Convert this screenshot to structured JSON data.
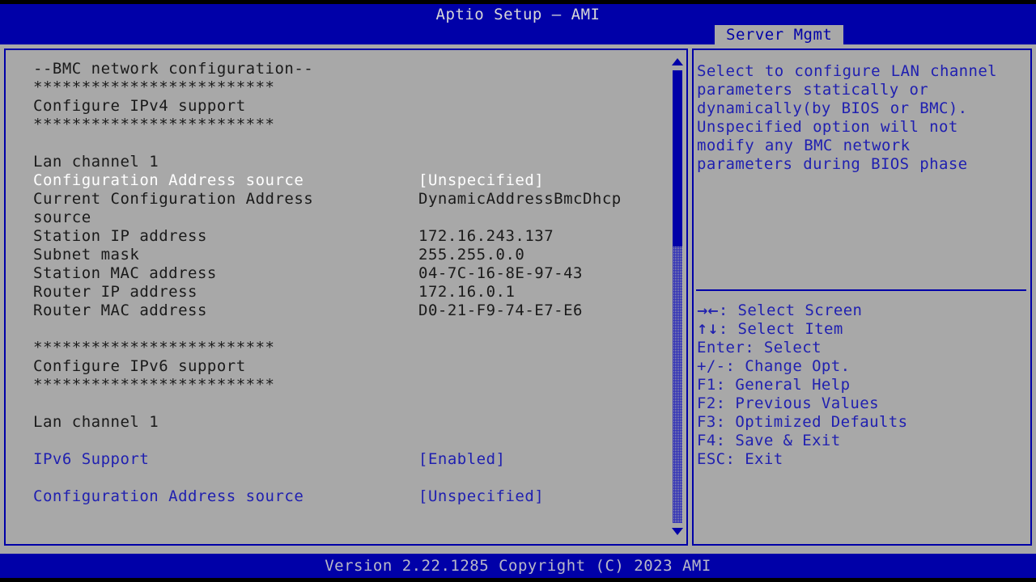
{
  "window": {
    "title": "Aptio Setup – AMI"
  },
  "tabs": {
    "active_label": "Server Mgmt"
  },
  "colors": {
    "blue": "#0000a8",
    "gray": "#a8a8a8",
    "text_blue": "#2020b0",
    "text_dark": "#1a1a1a",
    "text_selected": "#ffffff"
  },
  "content": {
    "rows": [
      {
        "label": "--BMC network configuration--",
        "value": "",
        "style": "dark"
      },
      {
        "label": "*************************",
        "value": "",
        "style": "dark"
      },
      {
        "label": "Configure IPv4 support",
        "value": "",
        "style": "dark"
      },
      {
        "label": "*************************",
        "value": "",
        "style": "dark"
      },
      {
        "label": "",
        "value": "",
        "style": "dark"
      },
      {
        "label": "Lan channel 1",
        "value": "",
        "style": "dark"
      },
      {
        "label": "Configuration Address source",
        "value": "[Unspecified]",
        "style": "selected"
      },
      {
        "label": "Current Configuration Address",
        "value": "DynamicAddressBmcDhcp",
        "style": "dark"
      },
      {
        "label": "source",
        "value": "",
        "style": "dark"
      },
      {
        "label": "Station IP address",
        "value": "172.16.243.137",
        "style": "dark"
      },
      {
        "label": "Subnet mask",
        "value": "255.255.0.0",
        "style": "dark"
      },
      {
        "label": "Station MAC address",
        "value": "04-7C-16-8E-97-43",
        "style": "dark"
      },
      {
        "label": "Router IP address",
        "value": "172.16.0.1",
        "style": "dark"
      },
      {
        "label": "Router MAC address",
        "value": "D0-21-F9-74-E7-E6",
        "style": "dark"
      },
      {
        "label": "",
        "value": "",
        "style": "dark"
      },
      {
        "label": "*************************",
        "value": "",
        "style": "dark"
      },
      {
        "label": "Configure IPv6 support",
        "value": "",
        "style": "dark"
      },
      {
        "label": "*************************",
        "value": "",
        "style": "dark"
      },
      {
        "label": "",
        "value": "",
        "style": "dark"
      },
      {
        "label": "Lan channel 1",
        "value": "",
        "style": "dark"
      },
      {
        "label": "",
        "value": "",
        "style": "dark"
      },
      {
        "label": "IPv6 Support",
        "value": "[Enabled]",
        "style": "blue"
      },
      {
        "label": "",
        "value": "",
        "style": "dark"
      },
      {
        "label": "Configuration Address source",
        "value": "[Unspecified]",
        "style": "blue"
      }
    ]
  },
  "scrollbar": {
    "up_arrow": "scroll-up-arrow",
    "down_arrow": "scroll-down-arrow",
    "thumb_position_percent": 0,
    "thumb_size_percent": 39
  },
  "help": {
    "text": "Select to configure LAN channel parameters statically or dynamically(by BIOS or BMC). Unspecified option will not modify any BMC network parameters during BIOS phase",
    "keys": [
      {
        "glyph": "→←",
        "text": ": Select Screen"
      },
      {
        "glyph": "↑↓",
        "text": ": Select Item"
      },
      {
        "glyph": "",
        "text": "Enter: Select"
      },
      {
        "glyph": "",
        "text": "+/-: Change Opt."
      },
      {
        "glyph": "",
        "text": "F1: General Help"
      },
      {
        "glyph": "",
        "text": "F2: Previous Values"
      },
      {
        "glyph": "",
        "text": "F3: Optimized Defaults"
      },
      {
        "glyph": "",
        "text": "F4: Save & Exit"
      },
      {
        "glyph": "",
        "text": "ESC: Exit"
      }
    ]
  },
  "footer": {
    "version_text": "Version 2.22.1285 Copyright (C) 2023 AMI"
  }
}
